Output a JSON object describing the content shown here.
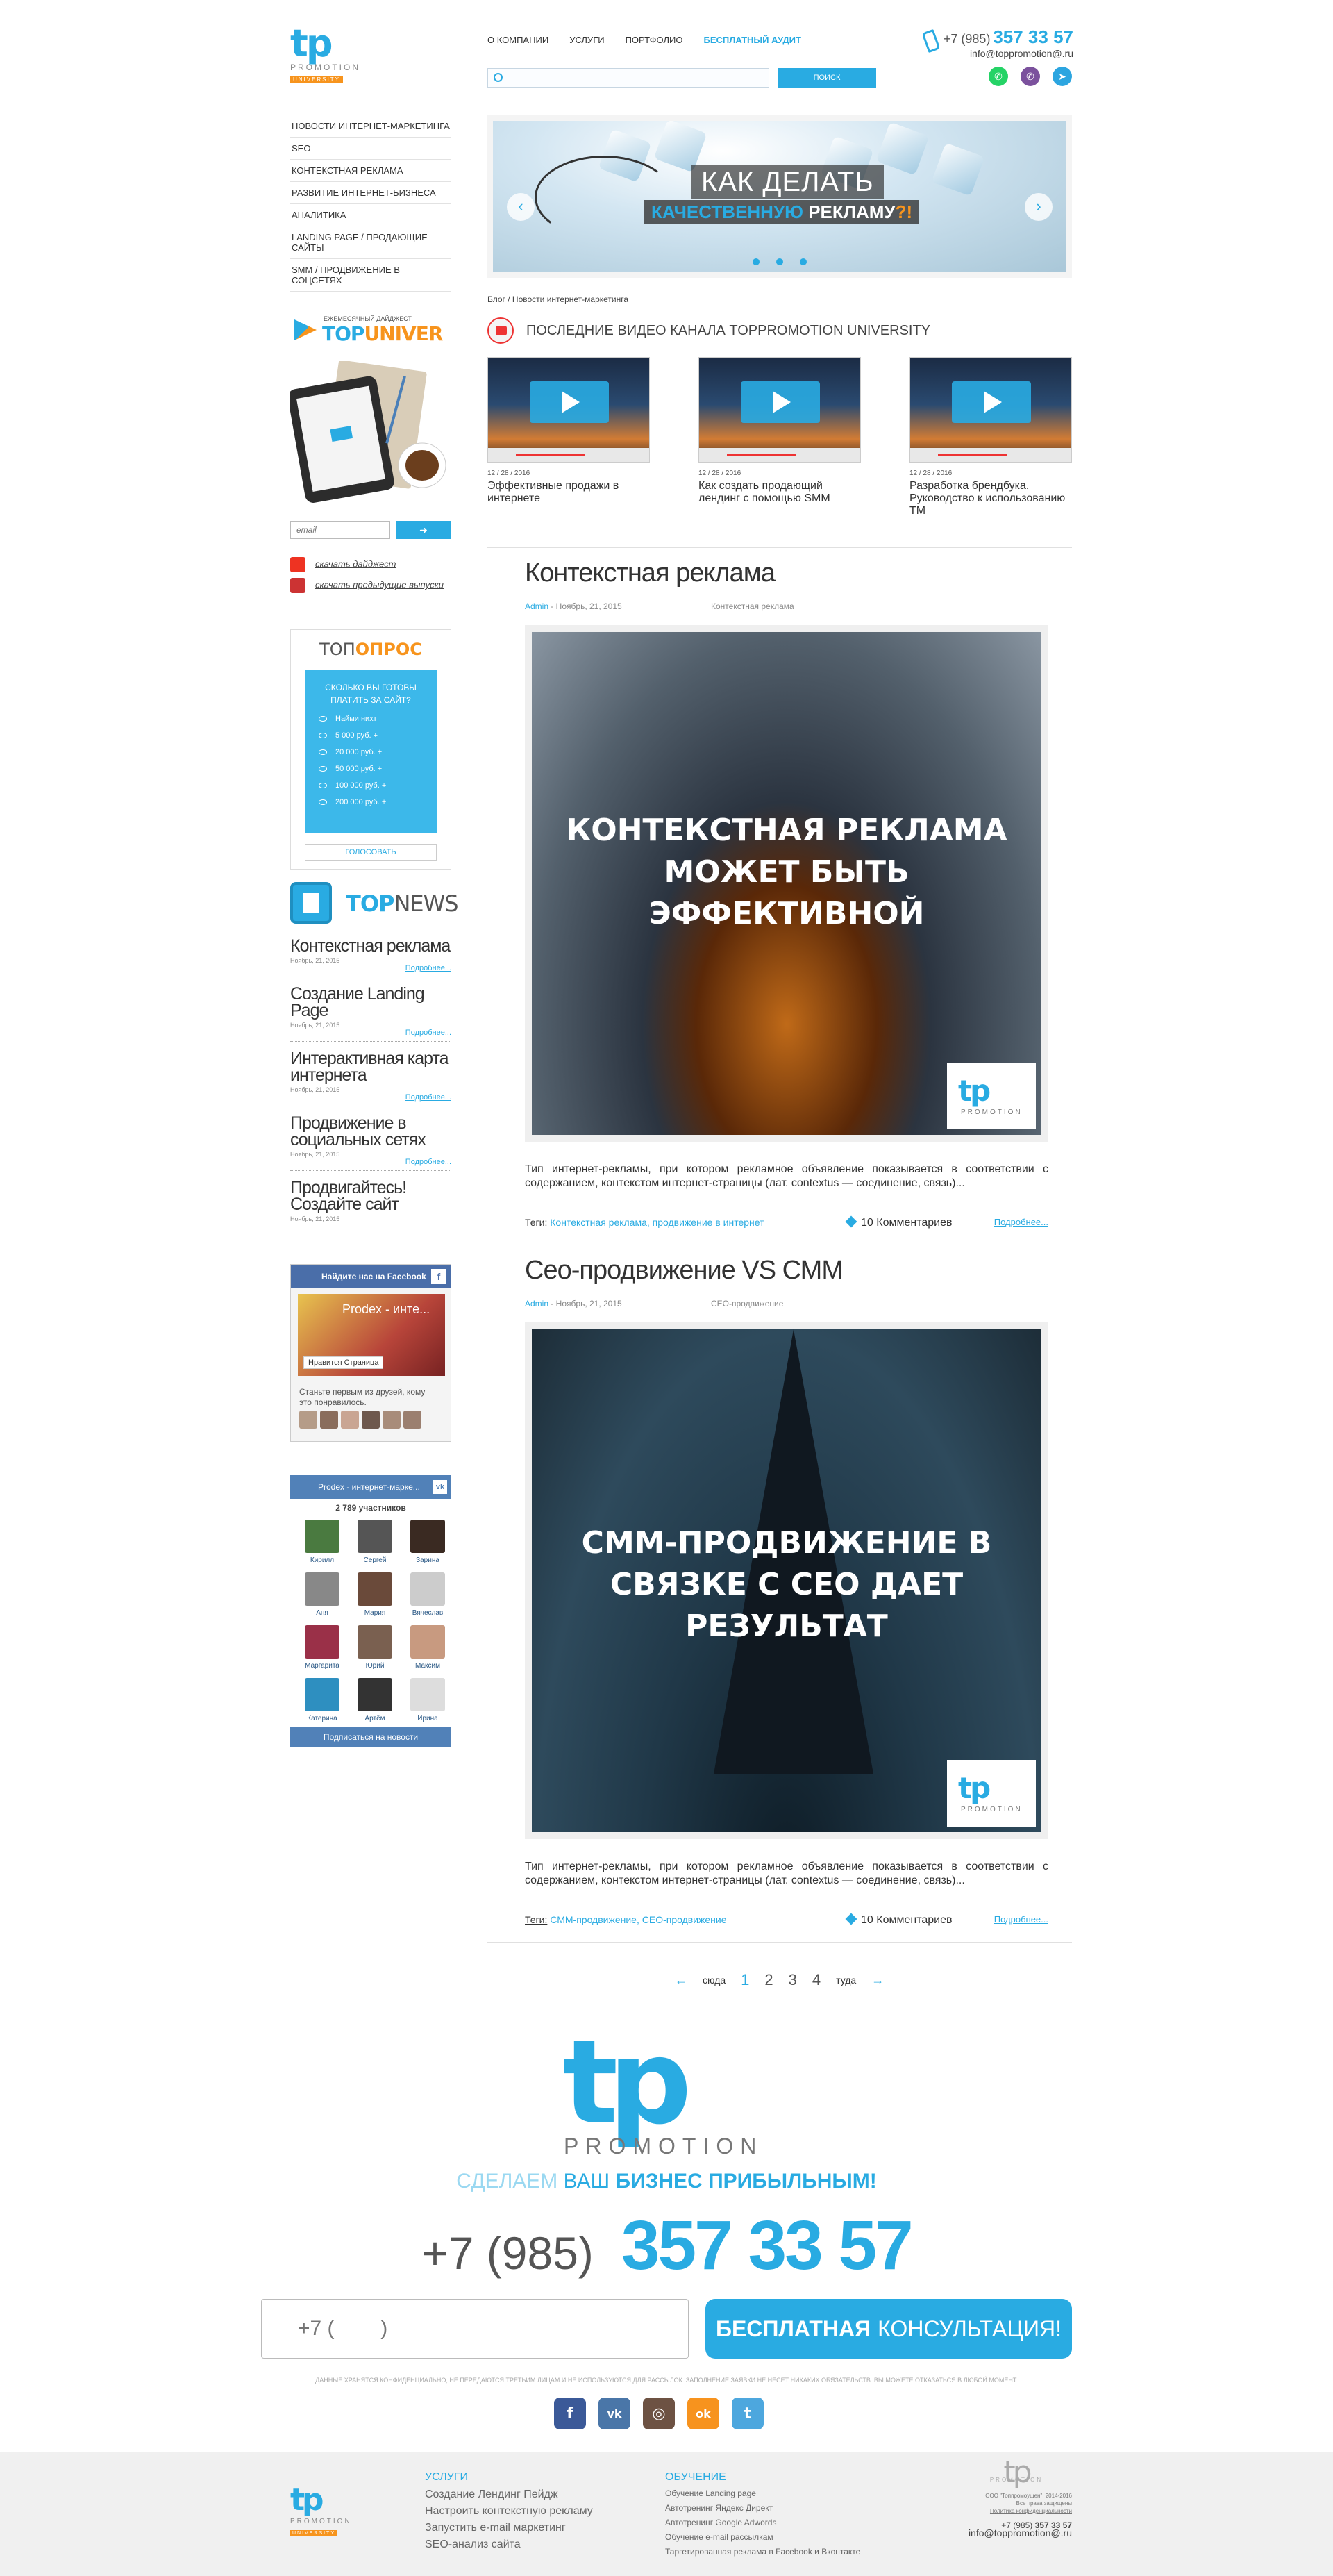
{
  "header": {
    "logo": {
      "main": "tp",
      "sub": "PROMOTION",
      "univer": "UNIVERSITY"
    },
    "nav": [
      "О компании",
      "Услуги",
      "Портфолио",
      "Бесплатный аудит"
    ],
    "search": {
      "placeholder": "",
      "button": "Поиск"
    },
    "phone": {
      "prefix": "+7 (985)",
      "number": "357 33 57",
      "email": "info@toppromotion@.ru"
    },
    "messengers": [
      {
        "name": "whatsapp",
        "color": "#25d366",
        "glyph": "✆"
      },
      {
        "name": "viber",
        "color": "#7b519d",
        "glyph": "✆"
      },
      {
        "name": "telegram",
        "color": "#2ca5e0",
        "glyph": "➤"
      }
    ]
  },
  "sidebar": {
    "menu": [
      "Новости интернет-маркетинга",
      "SEO",
      "Контекстная реклама",
      "Развитие интернет-бизнеса",
      "Аналитика",
      "Landing page / продающие сайты",
      "SMM / продвижение в соцсетях"
    ],
    "digest": {
      "subtitle": "Ежемесячный дайджест",
      "title_a": "TOP",
      "title_b": "UNIVER"
    },
    "email_placeholder": "email",
    "email_button": "➜",
    "downloads": [
      "скачать дайджест",
      "скачать предыдущие выпуски"
    ],
    "poll": {
      "title_a": "ТОП",
      "title_b": "ОПРОС",
      "question": "Сколько вы готовы платить за сайт?",
      "options": [
        "Найми нихт",
        "5 000 руб. +",
        "20 000 руб. +",
        "50 000 руб. +",
        "100 000 руб. +",
        "200 000 руб. +"
      ],
      "vote": "Голосовать"
    },
    "topnews": {
      "title_a": "TOP",
      "title_b": "NEWS",
      "items": [
        {
          "title": "Контекстная реклама",
          "date": "Ноябрь, 21, 2015",
          "more": "Подробнее..."
        },
        {
          "title": "Создание Landing Page",
          "date": "Ноябрь, 21, 2015",
          "more": "Подробнее..."
        },
        {
          "title": "Интерактивная карта интернета",
          "date": "Ноябрь, 21, 2015",
          "more": "Подробнее..."
        },
        {
          "title": "Продвижение в социальных сетях",
          "date": "Ноябрь, 21, 2015",
          "more": "Подробнее..."
        },
        {
          "title": "Продвигайтесь! Создайте сайт",
          "date": "Ноябрь, 21, 2015",
          "more": "Подробнее..."
        }
      ]
    },
    "facebook": {
      "header": "Найдите нас на Facebook",
      "page_name": "Prodex - инте...",
      "like": "Нравится Страница",
      "text": "Станьте первым из друзей, кому это понравилось."
    },
    "vk": {
      "header": "Prodex - интернет-марке...",
      "count": "2 789 участников",
      "members": [
        "Кирилл",
        "Сергей",
        "Зарина",
        "Аня",
        "Мария",
        "Вячеслав",
        "Маргарита",
        "Юрий",
        "Максим",
        "Катерина",
        "Артём",
        "Ирина"
      ],
      "subscribe": "Подписаться на новости"
    }
  },
  "slider": {
    "line1": "КАК ДЕЛАТЬ",
    "line2_a": "КАЧЕСТВЕННУЮ",
    "line2_b": "РЕКЛАМУ",
    "line2_c": "?!",
    "prev": "‹",
    "next": "›"
  },
  "breadcrumb": "Блог / Новости интернет-маркетинга",
  "videos": {
    "heading": "Последние видео канала Toppromotion University",
    "items": [
      {
        "date": "12 / 28 / 2016",
        "title": "Эффективные продажи в интернете"
      },
      {
        "date": "12 / 28 / 2016",
        "title": "Как создать продающий лендинг с помощью SMM"
      },
      {
        "date": "12 / 28 / 2016",
        "title": "Разработка брендбука. Руководство к использованию TM"
      }
    ]
  },
  "posts": [
    {
      "title": "Контекстная реклама",
      "author": "Admin",
      "date": " - Ноябрь, 21, 2015",
      "category": "Контекстная реклама",
      "image_caption": "КОНТЕКСТНАЯ РЕКЛАМА МОЖЕТ БЫТЬ ЭФФЕКТИВНОЙ",
      "excerpt": "Тип интернет-рекламы, при котором рекламное объявление показывается в соответствии с содержанием, контекстом интернет-страницы (лат. contextus — соединение, связь)...",
      "tags_label": "Теги:",
      "tags": " Контекстная реклама, продвижение в интернет",
      "comments": "10 Комментариев",
      "more": "Подробнее..."
    },
    {
      "title": "Сео-продвижение VS СММ",
      "author": "Admin",
      "date": " - Ноябрь, 21, 2015",
      "category": "СЕО-продвижение",
      "image_caption": "СММ-ПРОДВИЖЕНИЕ В СВЯЗКЕ С СЕО ДАЕТ РЕЗУЛЬТАТ",
      "excerpt": "Тип интернет-рекламы, при котором рекламное объявление показывается в соответствии с содержанием, контекстом интернет-страницы (лат. contextus — соединение, связь)...",
      "tags_label": "Теги:",
      "tags": " СММ-продвижение, СЕО-продвижение",
      "comments": "10 Комментариев",
      "more": "Подробнее..."
    }
  ],
  "watermark": {
    "main": "tp",
    "sub": "PROMOTION"
  },
  "pager": {
    "prev": "сюда",
    "next": "туда",
    "pages": [
      "1",
      "2",
      "3",
      "4"
    ]
  },
  "cta": {
    "logo_main": "tp",
    "logo_sub": "PROMOTION",
    "slogan_a": "Сделаем ",
    "slogan_b": "ваш ",
    "slogan_c": "бизнес прибыльным!",
    "phone_prefix": "+7 (985)",
    "phone_number": "357 33 57",
    "input_placeholder": "+7 (        )",
    "button_a": "Бесплатная",
    "button_b": "консультация!",
    "disclaimer": "Данные хранятся конфиденциально, не передаются третьим лицам и не используются для рассылок. Заполнение заявки не несет никаких обязательств. Вы можете отказаться в любой момент.",
    "socials": [
      {
        "name": "facebook",
        "glyph": "f",
        "color": "#3b5998"
      },
      {
        "name": "vkontakte",
        "glyph": "vk",
        "color": "#4a76a8"
      },
      {
        "name": "instagram",
        "glyph": "◎",
        "color": "#6d5243"
      },
      {
        "name": "odnoklassniki",
        "glyph": "ok",
        "color": "#f7931e"
      },
      {
        "name": "twitter",
        "glyph": "t",
        "color": "#4da7de"
      }
    ]
  },
  "footer": {
    "services_heading": "Услуги",
    "services": [
      "Создание Лендинг Пейдж",
      "Настроить контекстную рекламу",
      "Запустить e-mail маркетинг",
      "SEO-анализ сайта"
    ],
    "training_heading": "Обучение",
    "training": [
      "Обучение Landing page",
      "Автотренинг Яндекс Директ",
      "Автотренинг Google Adwords",
      "Обучение e-mail рассылкам",
      "Таргетированная реклама в Facebook и Вконтакте"
    ],
    "company": "ООО \"Топпромоушен\", 2014-2016",
    "rights": "Все права защищены",
    "policy": "Политика конфиденциальности",
    "phone_prefix": "+7 (985) ",
    "phone_number": "357 33 57",
    "email": "info@toppromotion@.ru"
  }
}
